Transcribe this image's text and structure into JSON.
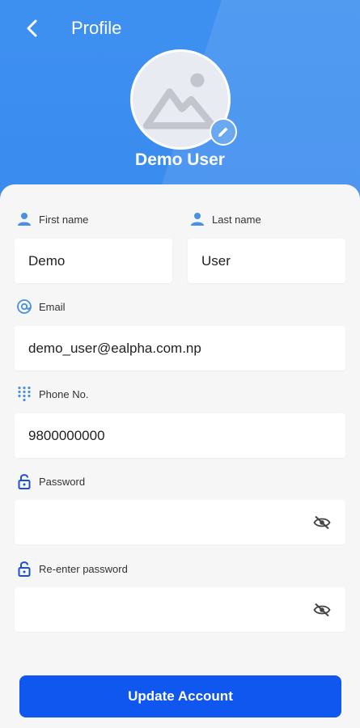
{
  "header": {
    "title": "Profile",
    "back_icon": "chevron-left-icon",
    "username": "Demo User",
    "avatar_icon": "image-placeholder-icon",
    "edit_icon": "pencil-icon"
  },
  "form": {
    "first_name": {
      "label": "First name",
      "value": "Demo",
      "icon": "person-icon"
    },
    "last_name": {
      "label": "Last name",
      "value": "User",
      "icon": "person-icon"
    },
    "email": {
      "label": "Email",
      "value": "demo_user@ealpha.com.np",
      "icon": "at-icon"
    },
    "phone": {
      "label": "Phone No.",
      "value": "9800000000",
      "icon": "dialpad-icon"
    },
    "password": {
      "label": "Password",
      "value": "",
      "icon": "lock-icon",
      "toggle_icon": "eye-off-icon"
    },
    "reenter_password": {
      "label": "Re-enter password",
      "value": "",
      "icon": "lock-icon",
      "toggle_icon": "eye-off-icon"
    }
  },
  "actions": {
    "update_label": "Update Account"
  },
  "colors": {
    "header": "#3e90f0",
    "button": "#0f57ef",
    "icon_accent": "#4a90e2",
    "card_bg": "#f6f6f6"
  }
}
